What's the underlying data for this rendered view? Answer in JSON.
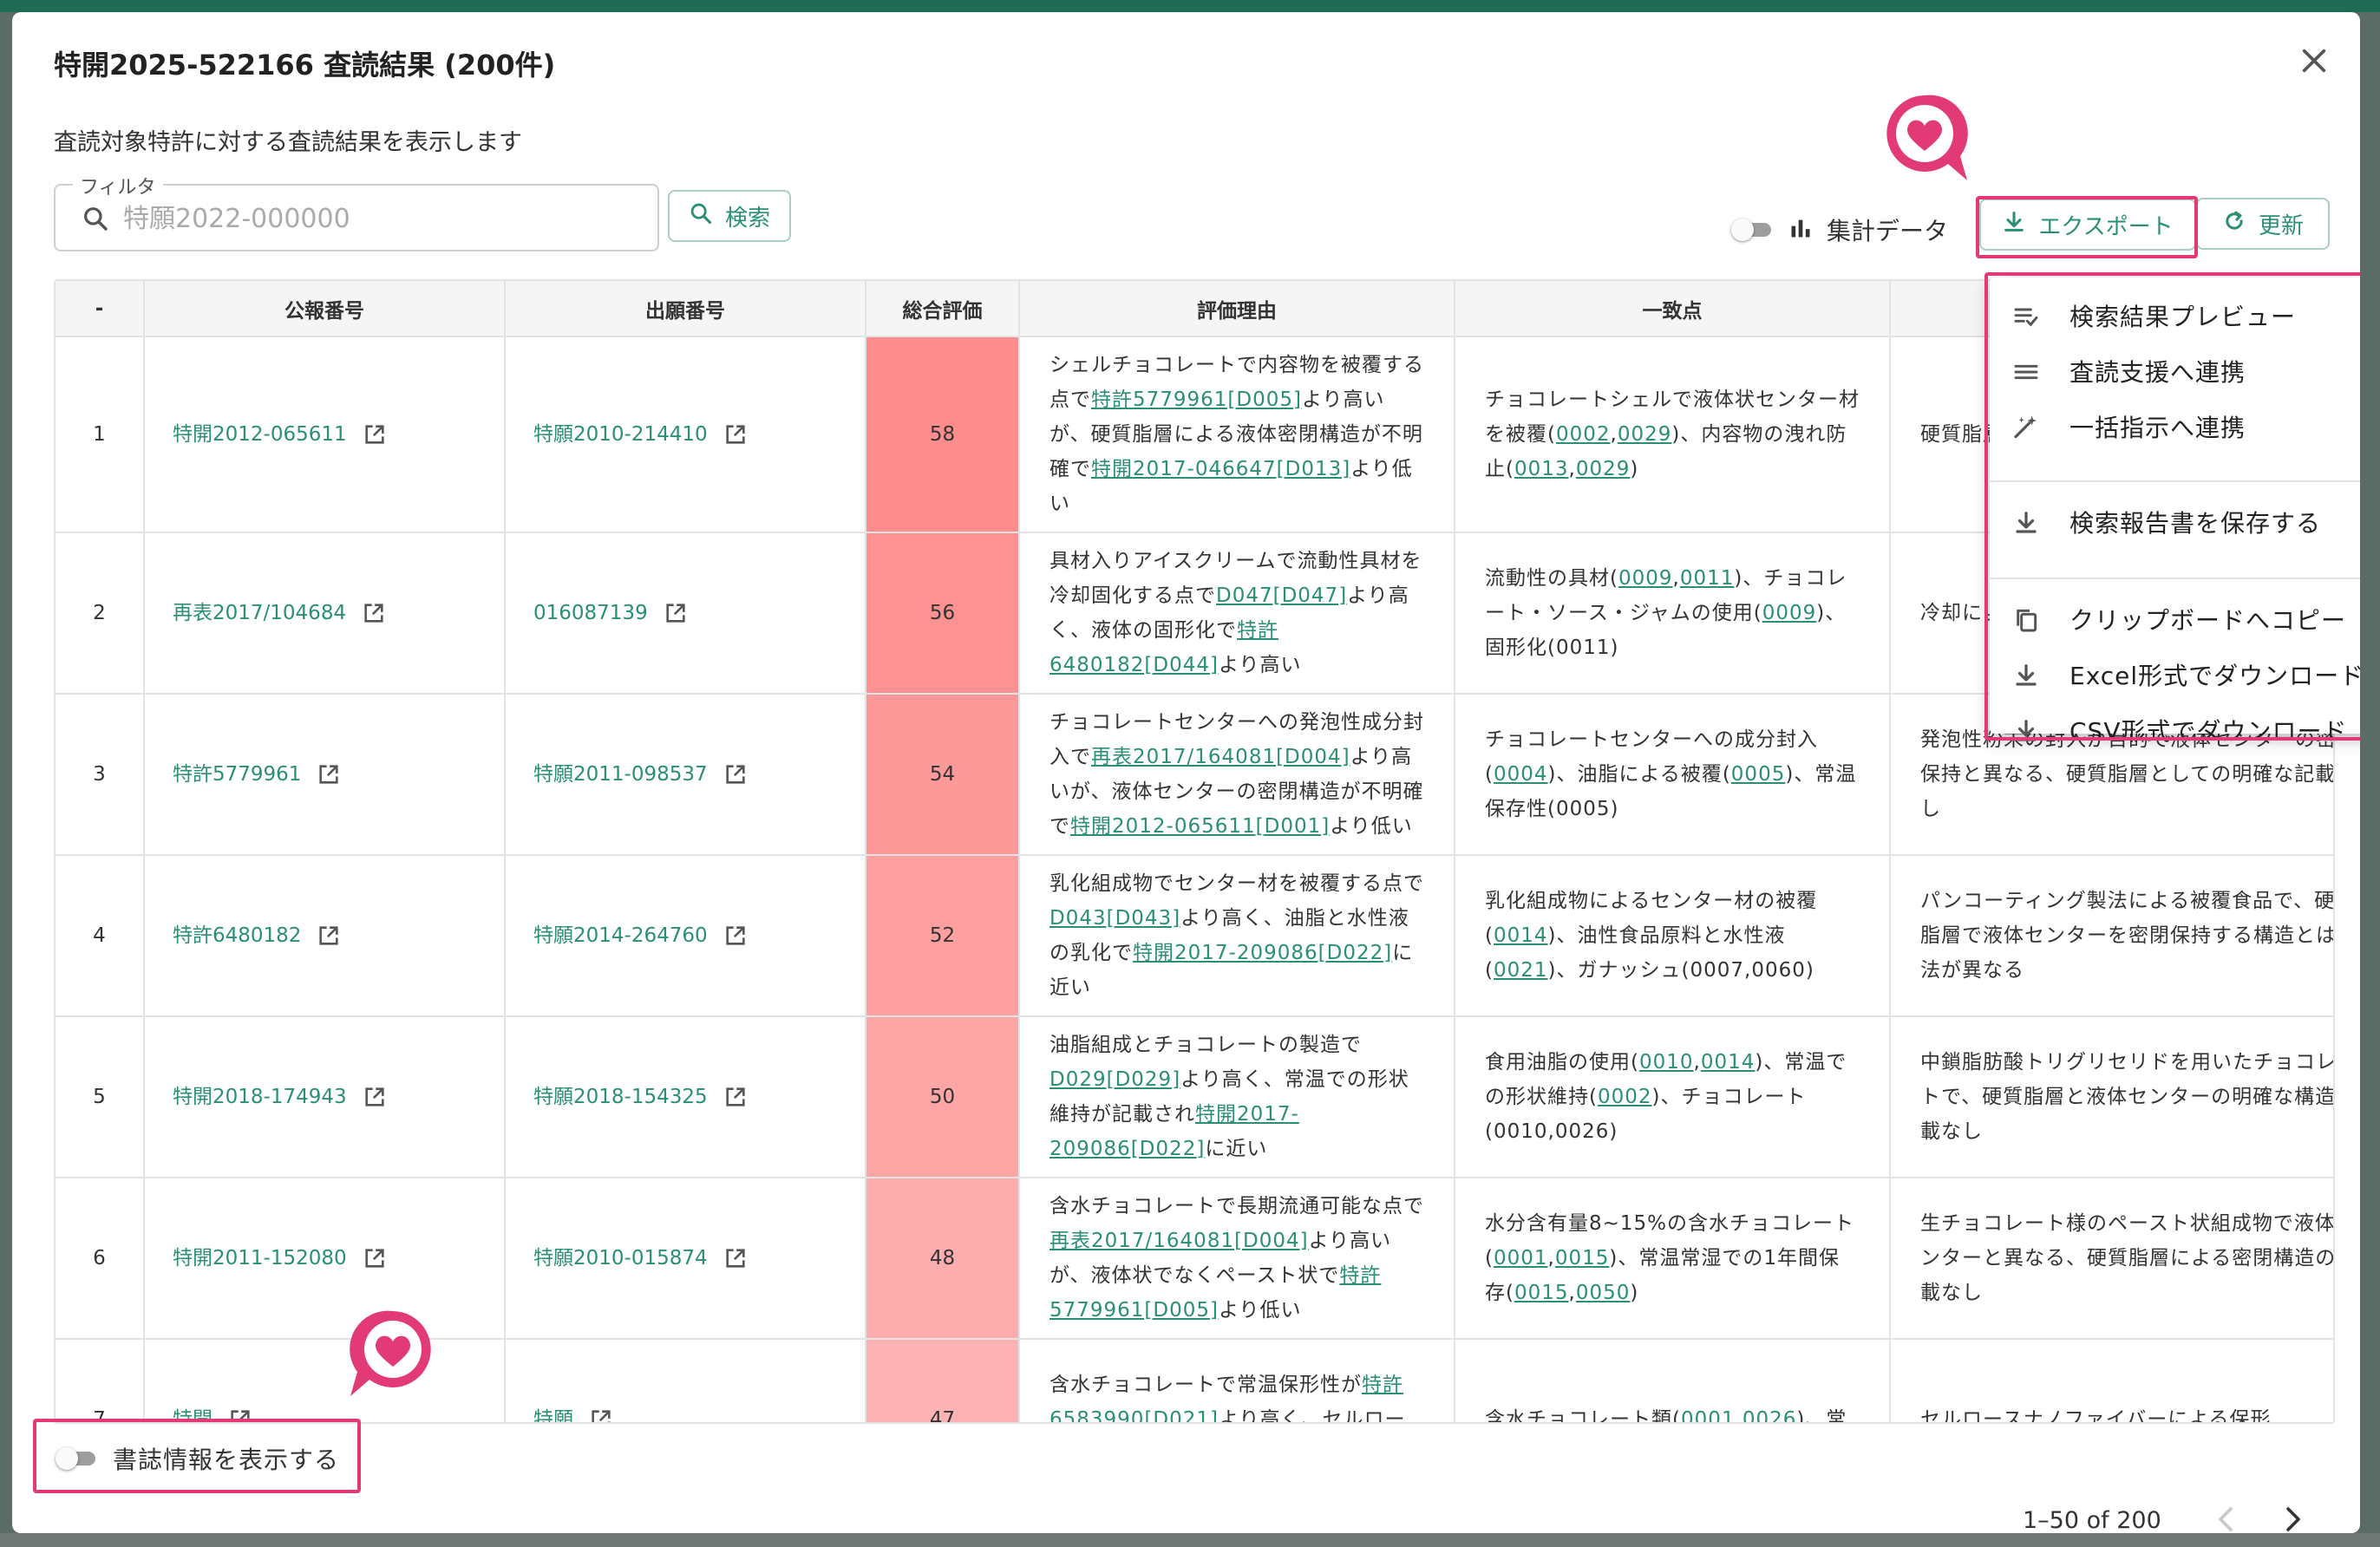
{
  "dialog": {
    "title": "特開2025-522166 査読結果 (200件)",
    "description": "査読対象特許に対する査読結果を表示します"
  },
  "filter": {
    "label": "フィルタ",
    "placeholder": "特願2022-000000",
    "search_label": "検索"
  },
  "toolbar": {
    "aggregate_label": "集計データ",
    "export_label": "エクスポート",
    "refresh_label": "更新"
  },
  "table": {
    "headers": [
      "-",
      "公報番号",
      "出願番号",
      "総合評価",
      "評価理由",
      "一致点",
      ""
    ],
    "rows": [
      {
        "index": "1",
        "pub": "特開2012-065611",
        "app": "特願2010-214410",
        "score": "58",
        "score_color": "#fe8d8c",
        "reason_pre": "シェルチョコレートで内容物を被覆する点で",
        "reason_ref1": "特許5779961[D005]",
        "reason_mid": "より高いが、硬質脂層による液体密閉構造が不明確で",
        "reason_ref2": "特開2017-046647[D013]",
        "reason_post": "より低い",
        "match_pre": "チョコレートシェルで液体状センター材を被覆(",
        "match_r1": "0002",
        "match_r2": "0029",
        "match_mid": ")、内容物の洩れ防止(",
        "match_r3": "0013",
        "match_r4": "0029",
        "match_post": ")",
        "diff": "硬質脂層の記載なし、その安定性"
      },
      {
        "index": "2",
        "pub": "再表2017/104684",
        "app": "016087139",
        "score": "56",
        "score_color": "#fe9292",
        "reason_pre": "具材入りアイスクリームで流動性具材を冷却固化する点で",
        "reason_ref1": "D047[D047]",
        "reason_mid": "より高く、液体の固形化で",
        "reason_ref2": "特許6480182[D044]",
        "reason_post": "より高い",
        "match_pre": "流動性の具材(",
        "match_r1": "0009",
        "match_r2": "0011",
        "match_mid": ")、チョコレート・ソース・ジャムの使用(",
        "match_r3": "0009",
        "match_r4": "",
        "match_post": ")、固形化(0011)",
        "diff": "冷却による常温で保持す"
      },
      {
        "index": "3",
        "pub": "特許5779961",
        "app": "特願2011-098537",
        "score": "54",
        "score_color": "#fe9999",
        "reason_pre": "チョコレートセンターへの発泡性成分封入で",
        "reason_ref1": "再表2017/164081[D004]",
        "reason_mid": "より高いが、液体センターの密閉構造が不明確で",
        "reason_ref2": "特開2012-065611[D001]",
        "reason_post": "より低い",
        "match_pre": "チョコレートセンターへの成分封入(",
        "match_r1": "0004",
        "match_r2": "",
        "match_mid": ")、油脂による被覆(",
        "match_r3": "0005",
        "match_r4": "",
        "match_post": ")、常温保存性(0005)",
        "diff": "発泡性粉末の封入が目的で液体センターの密閉保持と異なる、硬質脂層としての明確な記載なし"
      },
      {
        "index": "4",
        "pub": "特許6480182",
        "app": "特願2014-264760",
        "score": "52",
        "score_color": "#fea0a0",
        "reason_pre": "乳化組成物でセンター材を被覆する点で",
        "reason_ref1": "D043[D043]",
        "reason_mid": "より高く、油脂と水性液の乳化で",
        "reason_ref2": "特開2017-209086[D022]",
        "reason_post": "に近い",
        "match_pre": "乳化組成物によるセンター材の被覆(",
        "match_r1": "0014",
        "match_r2": "",
        "match_mid": ")、油性食品原料と水性液(",
        "match_r3": "0021",
        "match_r4": "",
        "match_post": ")、ガナッシュ(0007,0060)",
        "diff": "パンコーティング製法による被覆食品で、硬質脂層で液体センターを密閉保持する構造とは製法が異なる"
      },
      {
        "index": "5",
        "pub": "特開2018-174943",
        "app": "特願2018-154325",
        "score": "50",
        "score_color": "#fea6a6",
        "reason_pre": "油脂組成とチョコレートの製造で",
        "reason_ref1": "D029[D029]",
        "reason_mid": "より高く、常温での形状維持が記載され",
        "reason_ref2": "特開2017-209086[D022]",
        "reason_post": "に近い",
        "match_pre": "食用油脂の使用(",
        "match_r1": "0010",
        "match_r2": "0014",
        "match_mid": ")、常温での形状維持(",
        "match_r3": "0002",
        "match_r4": "",
        "match_post": ")、チョコレート(0010,0026)",
        "diff": "中鎖脂肪酸トリグリセリドを用いたチョコレートで、硬質脂層と液体センターの明確な構造記載なし"
      },
      {
        "index": "6",
        "pub": "特開2011-152080",
        "app": "特願2010-015874",
        "score": "48",
        "score_color": "#fdadad",
        "reason_pre": "含水チョコレートで長期流通可能な点で",
        "reason_ref1": "再表2017/164081[D004]",
        "reason_mid": "より高いが、液体状でなくペースト状で",
        "reason_ref2": "特許5779961[D005]",
        "reason_post": "より低い",
        "match_pre": "水分含有量8~15%の含水チョコレート(",
        "match_r1": "0001",
        "match_r2": "0015",
        "match_mid": ")、常温常湿での1年間保存(",
        "match_r3": "0015",
        "match_r4": "0050",
        "match_post": ")",
        "diff": "生チョコレート様のペースト状組成物で液体センターと異なる、硬質脂層による密閉構造の記載なし"
      },
      {
        "index": "7",
        "pub": "特開",
        "app": "特願",
        "score": "47",
        "score_color": "#fdb3b3",
        "reason_pre": "含水チョコレートで常温保形性が",
        "reason_ref1": "特許6583990[D021]",
        "reason_mid": "より高く、セルロース",
        "reason_ref2": "",
        "reason_post": "",
        "match_pre": "含水チョコレート類(",
        "match_r1": "0001",
        "match_r2": "0026",
        "match_mid": ")、常",
        "match_r3": "",
        "match_r4": "",
        "match_post": "",
        "diff": "セルロースナノファイバーによる保形"
      }
    ]
  },
  "export_menu": {
    "items": [
      {
        "label": "検索結果プレビュー",
        "icon": "preview-list-icon"
      },
      {
        "label": "査読支援へ連携",
        "icon": "menu-lines-icon"
      },
      {
        "label": "一括指示へ連携",
        "icon": "magic-wand-icon"
      },
      {
        "label": "検索報告書を保存する",
        "icon": "download-icon"
      },
      {
        "label": "クリップボードへコピー",
        "icon": "copy-icon"
      },
      {
        "label": "Excel形式でダウンロード",
        "icon": "download-icon"
      },
      {
        "label": "CSV形式でダウンロード",
        "icon": "download-icon"
      }
    ]
  },
  "footer": {
    "biblio_label": "書誌情報を表示する",
    "pagination": "1–50 of 200"
  },
  "colors": {
    "accent": "#2a8f75",
    "highlight": "#e23a76",
    "brand_bar": "#1f6b54"
  }
}
